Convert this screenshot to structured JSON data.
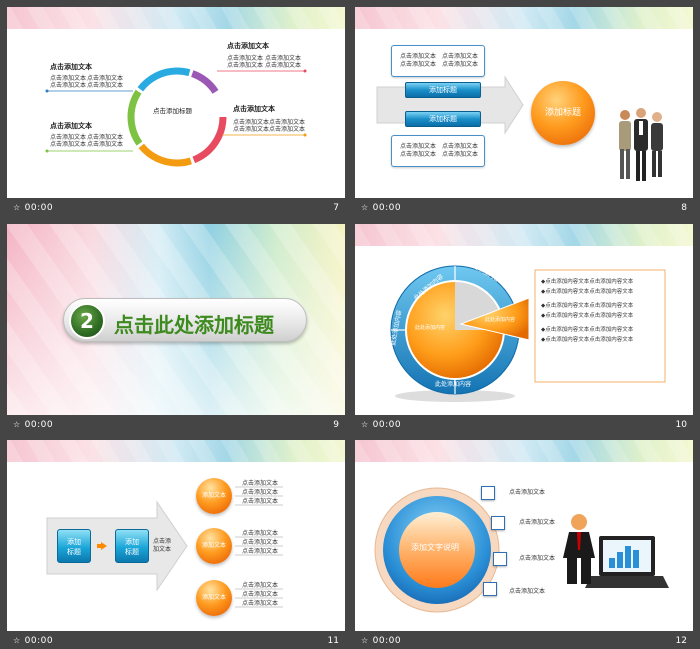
{
  "time_display": "00:00",
  "slides": [
    {
      "number": "7",
      "center_label": "点击添加标题",
      "groups": [
        {
          "title": "点击添加文本",
          "lines": [
            "点击添加文本",
            "点击添加文本",
            "点击添加文本",
            "点击添加文本"
          ]
        },
        {
          "title": "点击添加文本",
          "lines": [
            "点击添加文本",
            "点击添加文本",
            "点击添加文本",
            "点击添加文本"
          ]
        },
        {
          "title": "点击添加文本",
          "lines": [
            "点击添加文本",
            "点击添加文本",
            "点击添加文本",
            "点击添加文本"
          ]
        },
        {
          "title": "点击添加文本",
          "lines": [
            "点击添加文本",
            "点击添加文本",
            "点击添加文本",
            "点击添加文本"
          ]
        }
      ]
    },
    {
      "number": "8",
      "box_lines": [
        "点击添加文本",
        "点击添加文本"
      ],
      "button_label": "添加标题",
      "orb_label": "添加标题"
    },
    {
      "number": "9",
      "section_number": "2",
      "title": "点击此处添加标题"
    },
    {
      "number": "10",
      "ring_label": "此处添加内容",
      "slice_label": "此处添加内容",
      "bullet_text": "点击添加内容文本点击添加内容文本"
    },
    {
      "number": "11",
      "btn1": [
        "添加",
        "标题"
      ],
      "btn2": [
        "添加",
        "标题"
      ],
      "side_text": [
        "点击添",
        "加文本"
      ],
      "orb_label": "添加文本",
      "line_text": "点击添加文本"
    },
    {
      "number": "12",
      "circle_label": "添加文字说明",
      "item_text": "点击添加文本"
    }
  ],
  "colors": {
    "background": "#454545",
    "accent_blue": "#1a8fc9",
    "accent_orange": "#ff9b1e",
    "title_green": "#3d8a1e"
  }
}
